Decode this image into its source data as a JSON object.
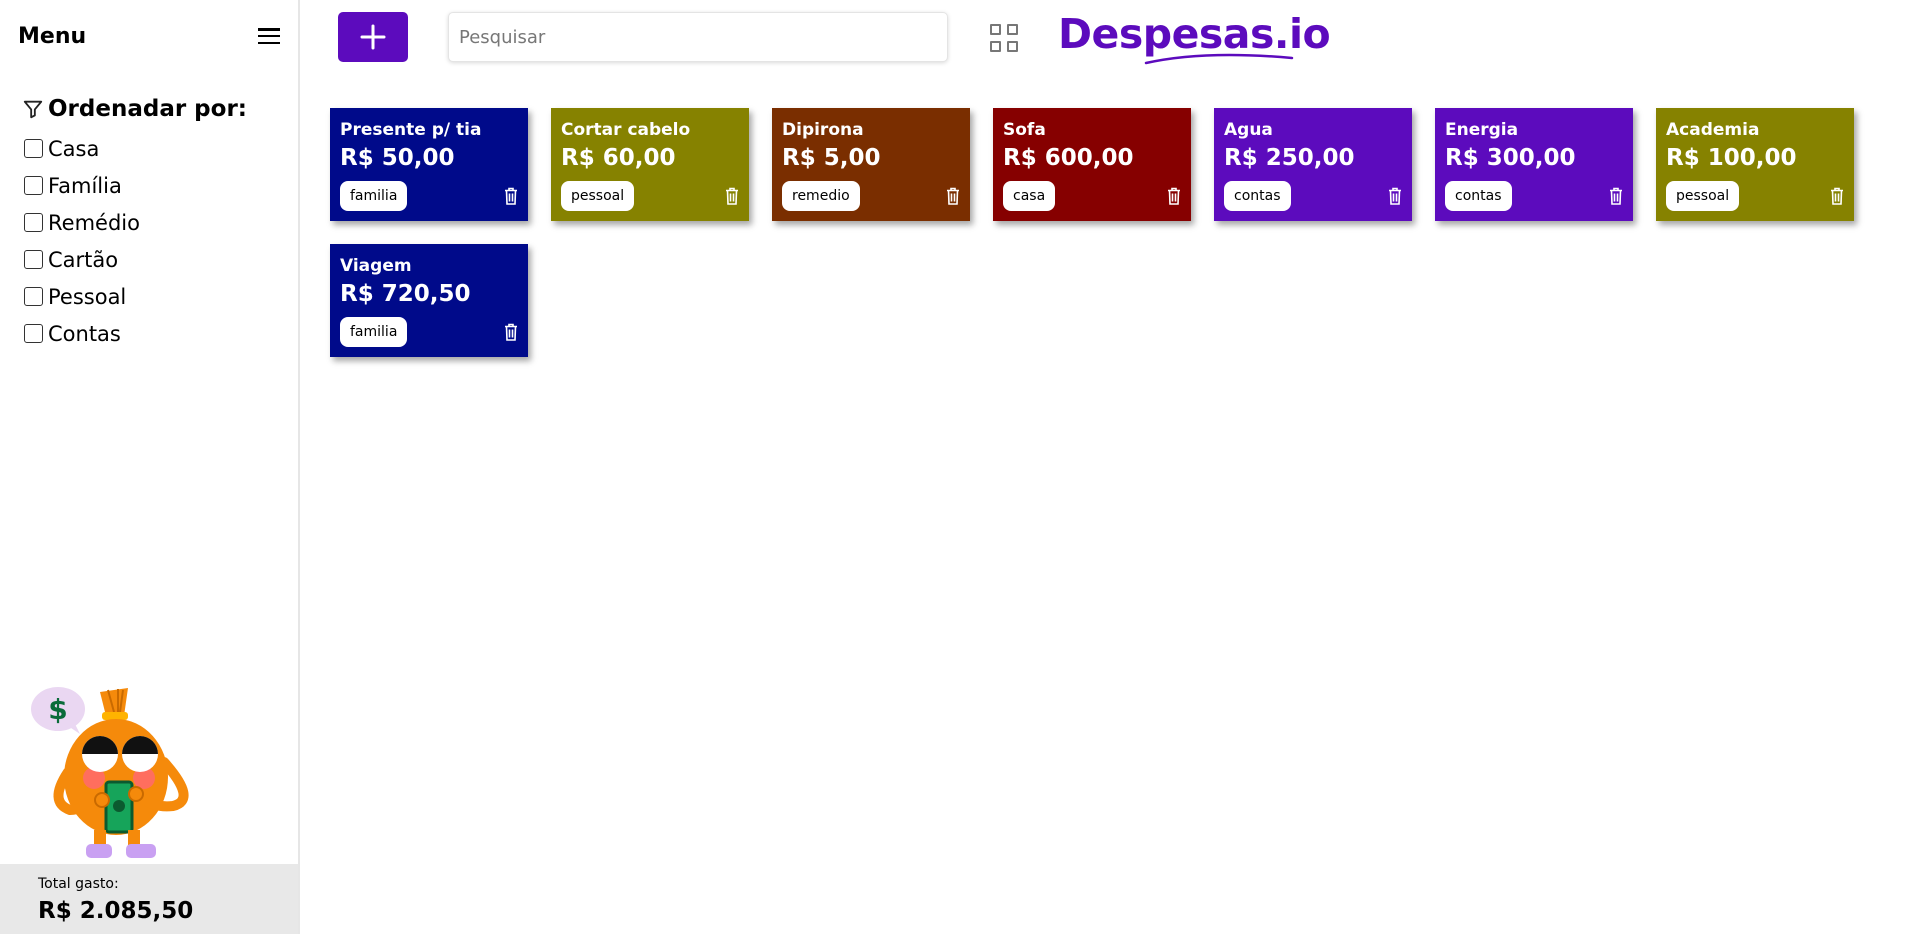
{
  "sidebar": {
    "menu_title": "Menu",
    "filter": {
      "title": "Ordenadar por:",
      "options": [
        "Casa",
        "Família",
        "Remédio",
        "Cartão",
        "Pessoal",
        "Contas"
      ]
    },
    "total": {
      "label": "Total gasto:",
      "value": "R$ 2.085,50"
    }
  },
  "topbar": {
    "add_label": "+",
    "search_placeholder": "Pesquisar",
    "logo": "Despesas.io"
  },
  "colors": {
    "brand": "#5c0bbd",
    "navy": "#000a8a",
    "olive": "#868200",
    "brown": "#7a2e00",
    "crimson": "#860000",
    "purple": "#5c0bbd"
  },
  "cards": [
    {
      "title": "Presente p/ tia",
      "amount": "R$ 50,00",
      "tag": "familia",
      "color": "#000a8a",
      "icon": "trash-icon"
    },
    {
      "title": "Cortar cabelo",
      "amount": "R$ 60,00",
      "tag": "pessoal",
      "color": "#868200",
      "icon": "trash-icon"
    },
    {
      "title": "Dipirona",
      "amount": "R$ 5,00",
      "tag": "remedio",
      "color": "#7a2e00",
      "icon": "trash-icon"
    },
    {
      "title": "Sofa",
      "amount": "R$ 600,00",
      "tag": "casa",
      "color": "#860000",
      "icon": "trash-icon"
    },
    {
      "title": "Agua",
      "amount": "R$ 250,00",
      "tag": "contas",
      "color": "#5c0bbd",
      "icon": "trash-icon"
    },
    {
      "title": "Energia",
      "amount": "R$ 300,00",
      "tag": "contas",
      "color": "#5c0bbd",
      "icon": "trash-icon"
    },
    {
      "title": "Academia",
      "amount": "R$ 100,00",
      "tag": "pessoal",
      "color": "#868200",
      "icon": "trash-icon"
    },
    {
      "title": "Viagem",
      "amount": "R$ 720,50",
      "tag": "familia",
      "color": "#000a8a",
      "icon": "trash-icon"
    }
  ]
}
